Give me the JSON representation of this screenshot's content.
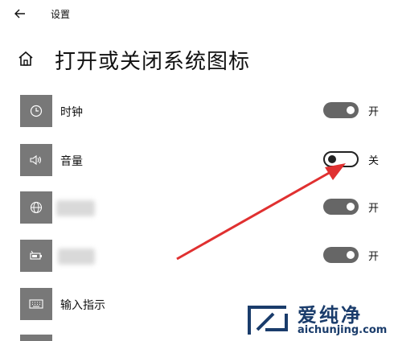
{
  "header": {
    "back_icon": "back-arrow-icon",
    "app_title": "设置"
  },
  "page": {
    "home_icon": "home-icon",
    "title": "打开或关闭系统图标"
  },
  "items": [
    {
      "icon": "clock-icon",
      "label": "时钟",
      "state": "开",
      "on": true
    },
    {
      "icon": "volume-icon",
      "label": "音量",
      "state": "关",
      "on": false
    },
    {
      "icon": "network-icon",
      "label": "",
      "state": "开",
      "on": true
    },
    {
      "icon": "battery-icon",
      "label": "",
      "state": "开",
      "on": true
    },
    {
      "icon": "keyboard-icon",
      "label": "输入指示"
    }
  ],
  "watermark": {
    "text": "爱纯净",
    "url": "aichunjing.com"
  },
  "colors": {
    "tile": "#787878",
    "toggle_on": "#666666",
    "arrow": "#e03030"
  }
}
